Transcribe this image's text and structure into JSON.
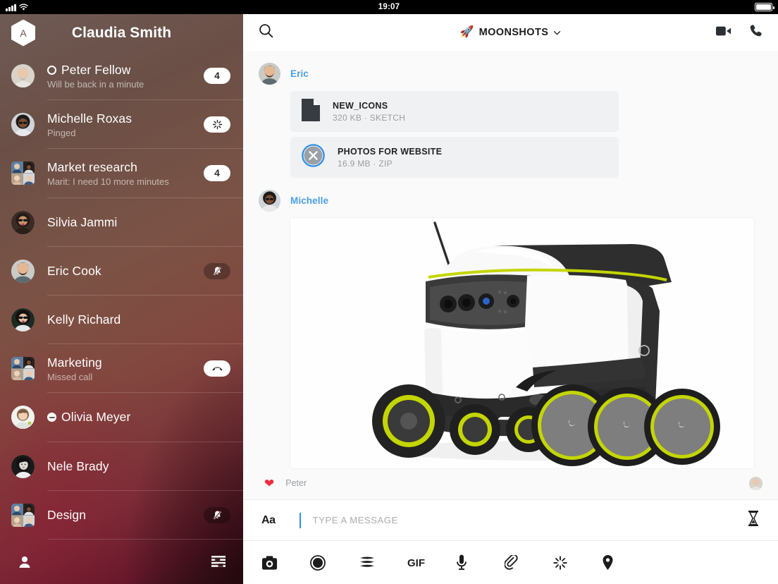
{
  "status_bar": {
    "time": "19:07",
    "signal_icon": "cellular-bars-icon",
    "wifi_icon": "wifi-icon",
    "battery_icon": "battery-icon"
  },
  "sidebar": {
    "account_initial": "A",
    "title": "Claudia Smith",
    "footer": {
      "profile_icon": "person-icon",
      "filter_icon": "list-filter-icon"
    },
    "conversations": [
      {
        "name": "Peter Fellow",
        "subtitle": "Will be back in a minute",
        "status": "away",
        "badge_type": "count",
        "badge": "4",
        "avatar": "photo-man-gray-beard",
        "group": false
      },
      {
        "name": "Michelle Roxas",
        "subtitle": "Pinged",
        "status": "none",
        "badge_type": "ping",
        "badge": "",
        "avatar": "photo-woman-afro-glasses",
        "group": false
      },
      {
        "name": "Market research",
        "subtitle": "Marit: I need 10 more minutes",
        "status": "none",
        "badge_type": "count",
        "badge": "4",
        "avatar": "group-collage",
        "group": true
      },
      {
        "name": "Silvia Jammi",
        "subtitle": "",
        "status": "none",
        "badge_type": "none",
        "badge": "",
        "avatar": "photo-woman-sunglasses",
        "group": false
      },
      {
        "name": "Eric Cook",
        "subtitle": "",
        "status": "none",
        "badge_type": "muted",
        "badge": "",
        "avatar": "photo-man-beard",
        "group": false
      },
      {
        "name": "Kelly Richard",
        "subtitle": "",
        "status": "none",
        "badge_type": "none",
        "badge": "",
        "avatar": "photo-woman-dark-glasses",
        "group": false
      },
      {
        "name": "Marketing",
        "subtitle": "Missed call",
        "status": "none",
        "badge_type": "missed-call",
        "badge": "",
        "avatar": "group-collage",
        "group": true
      },
      {
        "name": "Olivia Meyer",
        "subtitle": "",
        "status": "dnd",
        "badge_type": "none",
        "badge": "",
        "avatar": "photo-woman-short-hair",
        "group": false
      },
      {
        "name": "Nele Brady",
        "subtitle": "",
        "status": "none",
        "badge_type": "none",
        "badge": "",
        "avatar": "photo-woman-bw",
        "group": false
      },
      {
        "name": "Design",
        "subtitle": "",
        "status": "none",
        "badge_type": "muted",
        "badge": "",
        "avatar": "group-collage",
        "group": true
      }
    ]
  },
  "topbar": {
    "search_icon": "search-icon",
    "channel_emoji": "🚀",
    "channel_name": "MOONSHOTS",
    "chevron_icon": "chevron-down-icon",
    "video_icon": "video-camera-icon",
    "call_icon": "phone-icon"
  },
  "thread": {
    "messages": [
      {
        "author": "Eric",
        "avatar": "photo-man-beard",
        "attachments": [
          {
            "title": "NEW_ICONS",
            "meta": "320 KB · SKETCH",
            "icon": "file-document-icon"
          },
          {
            "title": "PHOTOS FOR WEBSITE",
            "meta": "16.9 MB · ZIP",
            "icon": "cancel-upload-icon"
          }
        ]
      },
      {
        "author": "Michelle",
        "avatar": "photo-woman-afro-glasses",
        "image": "delivery-robot-photo"
      }
    ],
    "reaction": {
      "emoji": "❤",
      "by": "Peter",
      "seen_avatar": "photo-man-gray-beard"
    }
  },
  "composer": {
    "format_label": "Aa",
    "placeholder": "TYPE A MESSAGE",
    "value": "",
    "timer_icon": "hourglass-icon",
    "tools": [
      {
        "icon": "camera-icon"
      },
      {
        "icon": "record-icon"
      },
      {
        "icon": "stack-icon"
      },
      {
        "icon": "gif-icon",
        "label": "GIF"
      },
      {
        "icon": "microphone-icon"
      },
      {
        "icon": "paperclip-icon"
      },
      {
        "icon": "ping-sparkle-icon"
      },
      {
        "icon": "location-pin-icon"
      }
    ]
  },
  "colors": {
    "accent": "#4a9fe0",
    "heart": "#ed2c3b",
    "caret": "#2f90e8",
    "thread_bg": "#fafafa"
  }
}
